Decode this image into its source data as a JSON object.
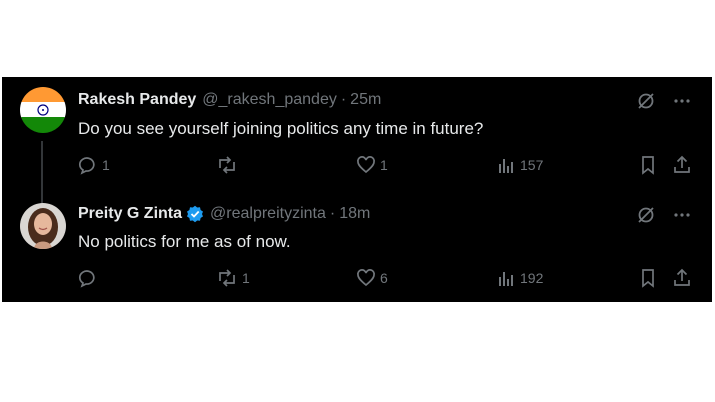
{
  "tweets": [
    {
      "name": "Rakesh Pandey",
      "handle": "@_rakesh_pandey",
      "separator": "·",
      "time": "25m",
      "text": "Do you see yourself joining politics any time in future?",
      "replies": "1",
      "retweets": "",
      "likes": "1",
      "views": "157",
      "verified": false
    },
    {
      "name": "Preity G Zinta",
      "handle": "@realpreityzinta",
      "separator": "·",
      "time": "18m",
      "text": "No politics for me as of now.",
      "replies": "",
      "retweets": "1",
      "likes": "6",
      "views": "192",
      "verified": true
    }
  ],
  "colors": {
    "background": "#000000",
    "text": "#e7e9ea",
    "muted": "#71767b",
    "verified": "#1d9bf0"
  },
  "icons": [
    "reply-icon",
    "retweet-icon",
    "like-icon",
    "views-icon",
    "bookmark-icon",
    "share-icon",
    "grok-icon",
    "more-icon",
    "verified-badge-icon"
  ]
}
